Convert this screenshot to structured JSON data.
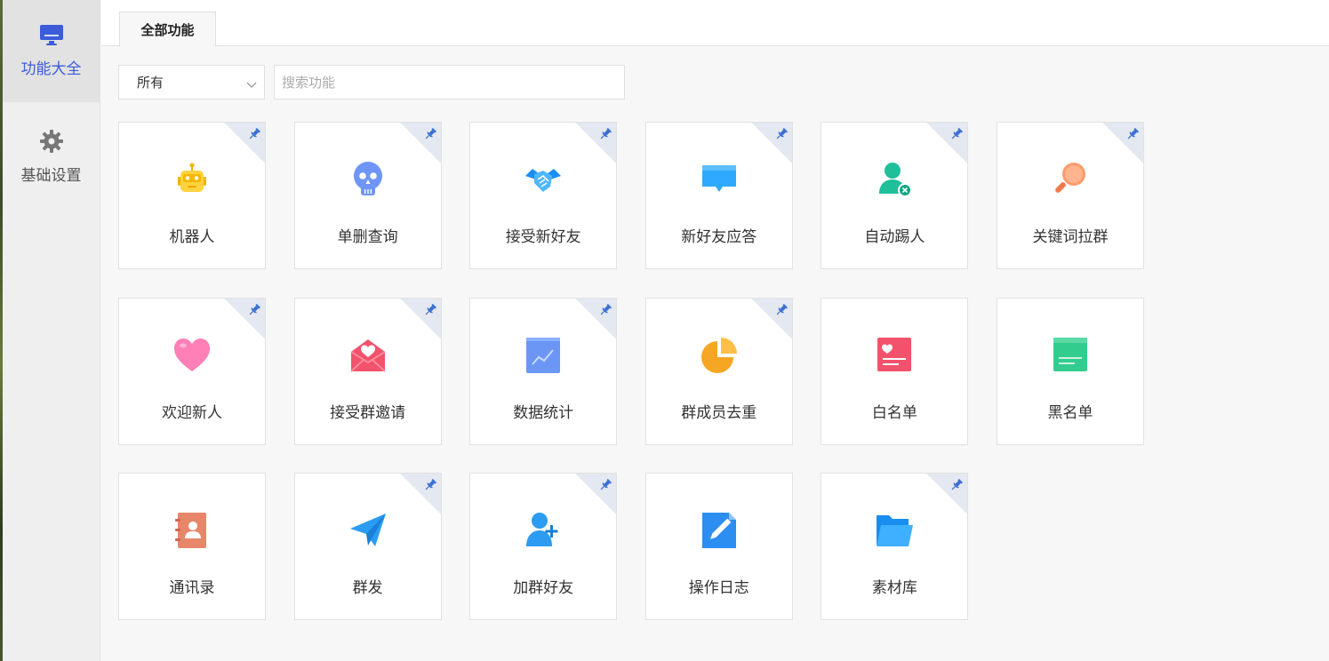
{
  "sidebar": {
    "items": [
      {
        "label": "功能大全",
        "icon": "monitor-icon",
        "active": true
      },
      {
        "label": "基础设置",
        "icon": "gear-icon",
        "active": false
      }
    ]
  },
  "tabs": [
    {
      "label": "全部功能"
    }
  ],
  "filter": {
    "selected": "所有"
  },
  "search": {
    "placeholder": "搜索功能",
    "value": ""
  },
  "colors": {
    "accent": "#3b5bdb",
    "pin": "#3b6fd4"
  },
  "cards": [
    {
      "label": "机器人",
      "icon": "robot-icon",
      "pinned": true
    },
    {
      "label": "单删查询",
      "icon": "skull-icon",
      "pinned": true
    },
    {
      "label": "接受新好友",
      "icon": "handshake-icon",
      "pinned": true
    },
    {
      "label": "新好友应答",
      "icon": "chat-bubble-icon",
      "pinned": true
    },
    {
      "label": "自动踢人",
      "icon": "user-remove-icon",
      "pinned": true
    },
    {
      "label": "关键词拉群",
      "icon": "magnifier-icon",
      "pinned": true
    },
    {
      "label": "欢迎新人",
      "icon": "heart-icon",
      "pinned": true
    },
    {
      "label": "接受群邀请",
      "icon": "envelope-heart-icon",
      "pinned": true
    },
    {
      "label": "数据统计",
      "icon": "line-chart-icon",
      "pinned": true
    },
    {
      "label": "群成员去重",
      "icon": "pie-chart-icon",
      "pinned": true
    },
    {
      "label": "白名单",
      "icon": "whitelist-icon",
      "pinned": false
    },
    {
      "label": "黑名单",
      "icon": "blacklist-icon",
      "pinned": false
    },
    {
      "label": "通讯录",
      "icon": "contacts-book-icon",
      "pinned": false
    },
    {
      "label": "群发",
      "icon": "paper-plane-icon",
      "pinned": true
    },
    {
      "label": "加群好友",
      "icon": "user-add-icon",
      "pinned": true
    },
    {
      "label": "操作日志",
      "icon": "edit-doc-icon",
      "pinned": false
    },
    {
      "label": "素材库",
      "icon": "folder-icon",
      "pinned": true
    }
  ]
}
